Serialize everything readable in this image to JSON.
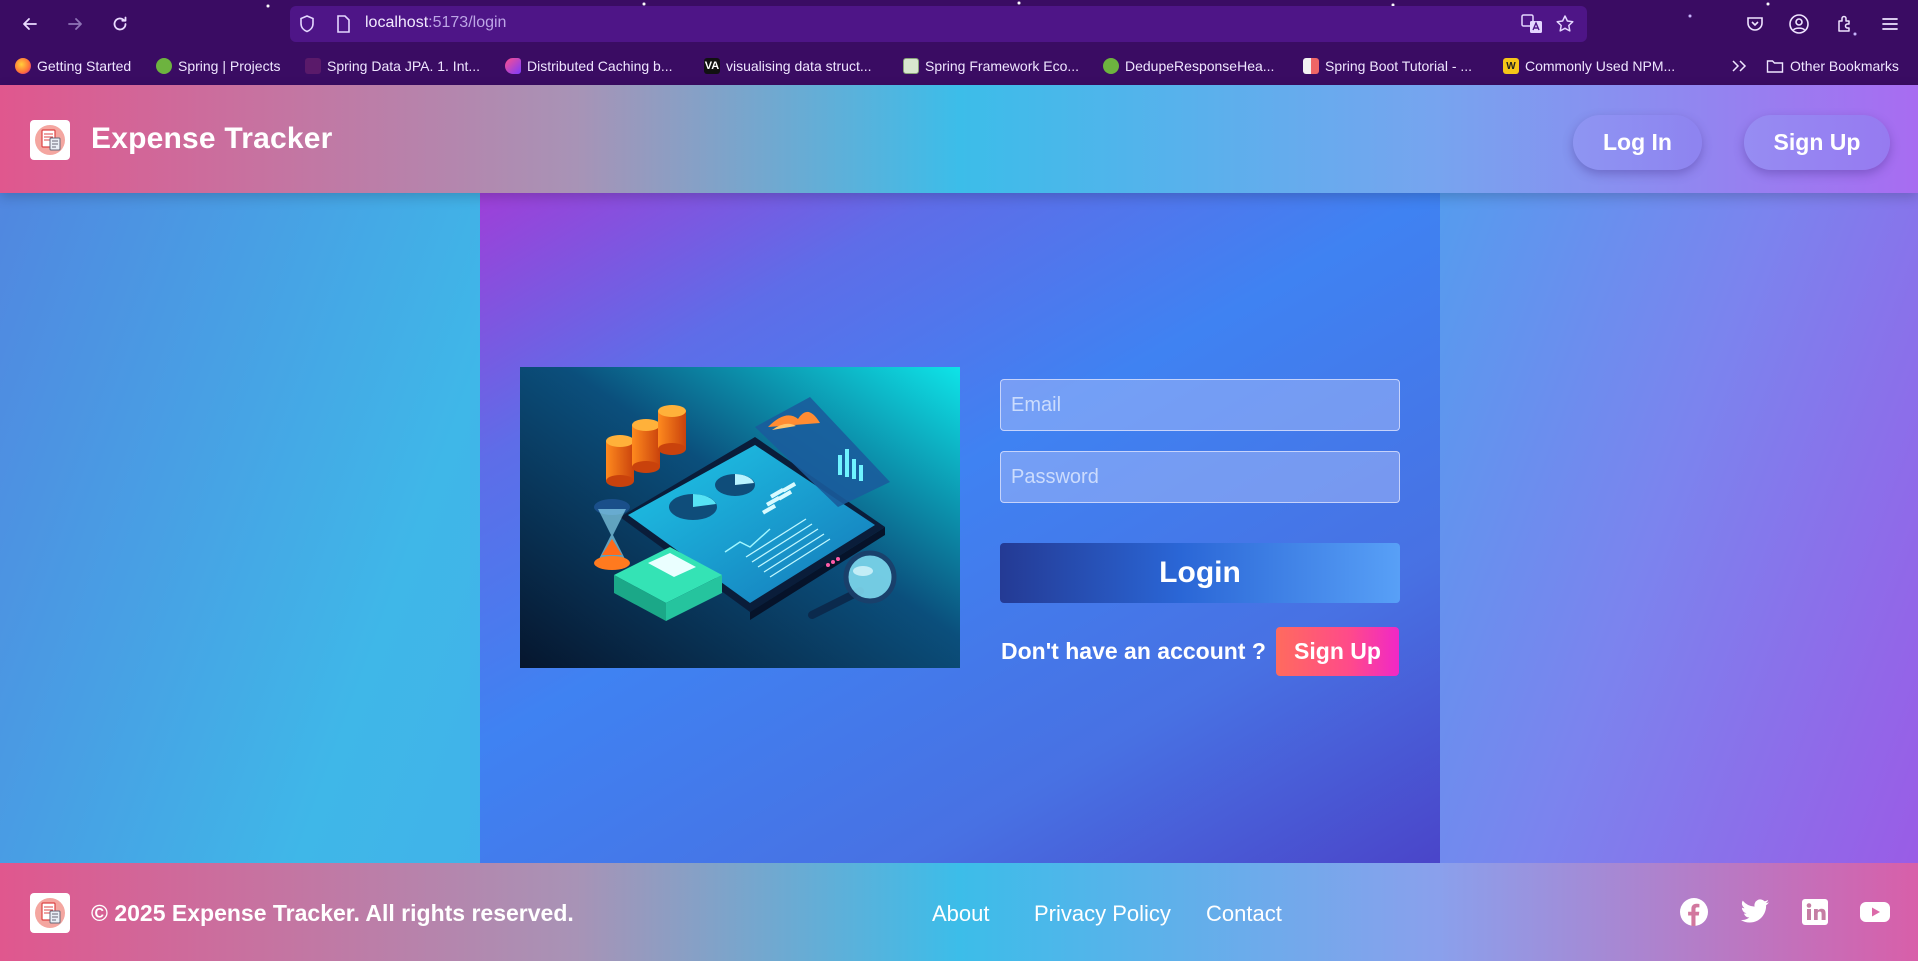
{
  "browser": {
    "url_host": "localhost",
    "url_path": ":5173/login",
    "bookmarks": [
      {
        "label": "Getting Started",
        "color": "#ff7139"
      },
      {
        "label": "Spring | Projects",
        "color": "#6db33f"
      },
      {
        "label": "Spring Data JPA. 1. Int...",
        "color": "#5a1a6a"
      },
      {
        "label": "Distributed Caching b...",
        "color": "#ff4f8b"
      },
      {
        "label": "visualising data struct...",
        "color": "#111111"
      },
      {
        "label": "Spring Framework Eco...",
        "color": "#d8e6cf"
      },
      {
        "label": "DedupeResponseHea...",
        "color": "#6db33f"
      },
      {
        "label": "Spring Boot Tutorial - ...",
        "color": "#f2f2f2"
      },
      {
        "label": "Commonly Used NPM...",
        "color": "#f5c518"
      }
    ],
    "other_bookmarks": "Other Bookmarks"
  },
  "header": {
    "title": "Expense Tracker",
    "login_label": "Log In",
    "signup_label": "Sign Up"
  },
  "login_form": {
    "email_placeholder": "Email",
    "password_placeholder": "Password",
    "submit_label": "Login",
    "no_account_text": "Don't have an account ?",
    "signup_label": "Sign Up"
  },
  "footer": {
    "copyright": "© 2025 Expense Tracker. All rights reserved.",
    "links": [
      "About",
      "Privacy Policy",
      "Contact"
    ],
    "social_icons": [
      "facebook-icon",
      "twitter-icon",
      "linkedin-icon",
      "youtube-icon"
    ]
  }
}
